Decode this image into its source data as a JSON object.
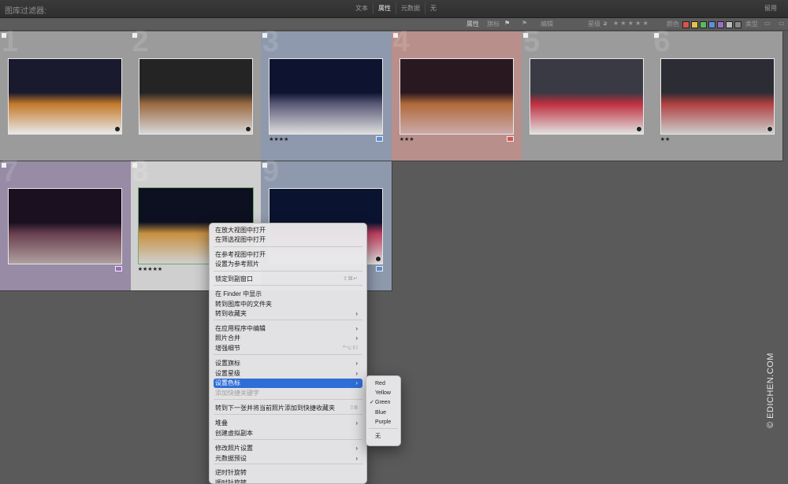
{
  "filter_bar": {
    "title": "图库过滤器:",
    "tabs": [
      "文本",
      "属性",
      "元数据",
      "无"
    ],
    "active_tab": "属性",
    "closed": "留用"
  },
  "attribute_bar": {
    "label": "属性",
    "flag_label": "旗标",
    "edit_label": "编辑",
    "rating_label": "星级",
    "rating_op": "≥",
    "rating_stars": "★ ★ ★ ★ ★",
    "color_label": "颜色",
    "kind_label": "类型",
    "swatch_colors": [
      "#d9534f",
      "#e0c44a",
      "#5cb85c",
      "#5b8fd6",
      "#9b6fbf",
      "#bbbbbb",
      "#888888"
    ]
  },
  "grid": {
    "cells": [
      {
        "num": "1",
        "stars": "",
        "bg": "#9b9b9b"
      },
      {
        "num": "2",
        "stars": "",
        "bg": "#9b9b9b"
      },
      {
        "num": "3",
        "stars": "★★★★",
        "bg": "#8e99ad"
      },
      {
        "num": "4",
        "stars": "★★★",
        "bg": "#b98f8b"
      },
      {
        "num": "5",
        "stars": "",
        "bg": "#9b9b9b"
      },
      {
        "num": "6",
        "stars": "★★",
        "bg": "#9b9b9b"
      },
      {
        "num": "7",
        "stars": "",
        "bg": "#978ba5"
      },
      {
        "num": "8",
        "stars": "★★★★★",
        "bg": "#cfcfcf"
      },
      {
        "num": "9",
        "stars": "",
        "bg": "#8e99ad"
      }
    ]
  },
  "context_menu": {
    "items": [
      {
        "label": "在放大视图中打开"
      },
      {
        "label": "在筛选视图中打开"
      },
      {
        "label": "在参考视图中打开"
      },
      {
        "label": "设置为参考照片"
      },
      {
        "label": "锁定到副窗口",
        "shortcut": "⇧⌘↵"
      },
      {
        "label": "在 Finder 中显示"
      },
      {
        "label": "转到图库中的文件夹"
      },
      {
        "label": "转到收藏夹"
      },
      {
        "label": "在应用程序中编辑"
      },
      {
        "label": "照片合并"
      },
      {
        "label": "增强细节",
        "shortcut": "^⌥⇧I"
      },
      {
        "label": "设置旗标"
      },
      {
        "label": "设置星级"
      },
      {
        "label": "设置色标"
      },
      {
        "label": "添加快捷关键字"
      },
      {
        "label": "转到下一张并将当前照片添加到快捷收藏夹",
        "shortcut": "⇧B"
      },
      {
        "label": "堆叠"
      },
      {
        "label": "创建虚拟副本"
      },
      {
        "label": "修改照片设置"
      },
      {
        "label": "元数据预设"
      },
      {
        "label": "逆时针旋转"
      },
      {
        "label": "顺时针旋转"
      }
    ]
  },
  "color_submenu": {
    "items": [
      "Red",
      "Yellow",
      "Green",
      "Blue",
      "Purple",
      "无"
    ],
    "checked": "✓"
  },
  "watermark": "© EDICHEN.COM"
}
